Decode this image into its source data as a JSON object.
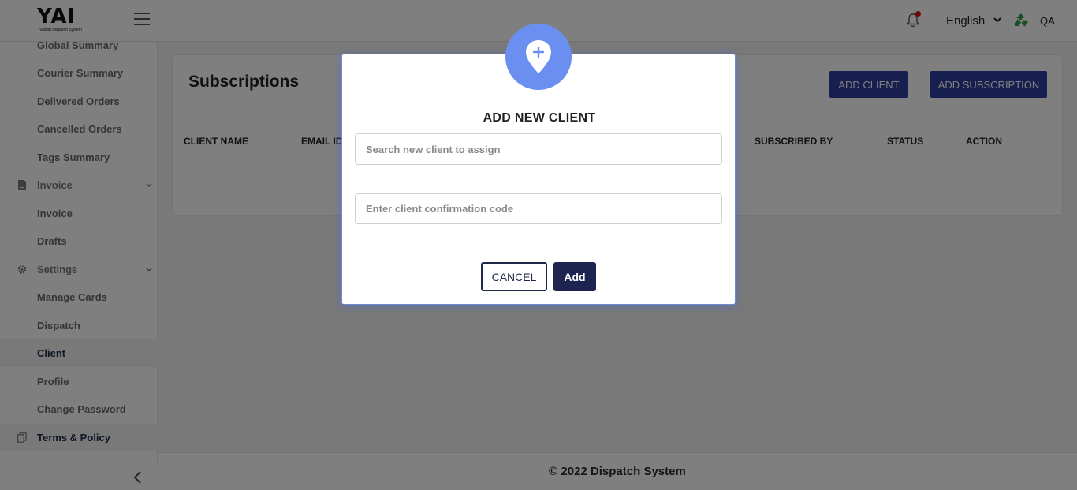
{
  "header": {
    "logo_text": "YAI",
    "logo_subtitle": "Vaistat Dispatch System",
    "language": "English",
    "user": "QA"
  },
  "sidebar": {
    "items": [
      {
        "label": "Global Summary"
      },
      {
        "label": "Courier Summary"
      },
      {
        "label": "Delivered Orders"
      },
      {
        "label": "Cancelled Orders"
      },
      {
        "label": "Tags Summary"
      },
      {
        "label": "Invoice"
      },
      {
        "label": "Invoice"
      },
      {
        "label": "Drafts"
      },
      {
        "label": "Settings"
      },
      {
        "label": "Manage Cards"
      },
      {
        "label": "Dispatch"
      },
      {
        "label": "Client"
      },
      {
        "label": "Profile"
      },
      {
        "label": "Change Password"
      },
      {
        "label": "Terms & Policy"
      }
    ]
  },
  "main": {
    "title": "Subscriptions",
    "add_client_label": "ADD CLIENT",
    "add_subscription_label": "ADD SUBSCRIPTION",
    "columns": [
      "CLIENT NAME",
      "EMAIL ID",
      "SUBSCRIBED BY",
      "STATUS",
      "ACTION"
    ]
  },
  "footer": {
    "text": "© 2022 Dispatch System"
  },
  "modal": {
    "title": "ADD NEW CLIENT",
    "search_placeholder": "Search new client to assign",
    "code_placeholder": "Enter client confirmation code",
    "cancel_label": "CANCEL",
    "add_label": "Add"
  },
  "colors": {
    "primary": "#2c3e9e",
    "dark_navy": "#1d2450",
    "modal_icon": "#6a8ff0",
    "notification": "#dd1111",
    "recycle": "#2e9e4a"
  }
}
